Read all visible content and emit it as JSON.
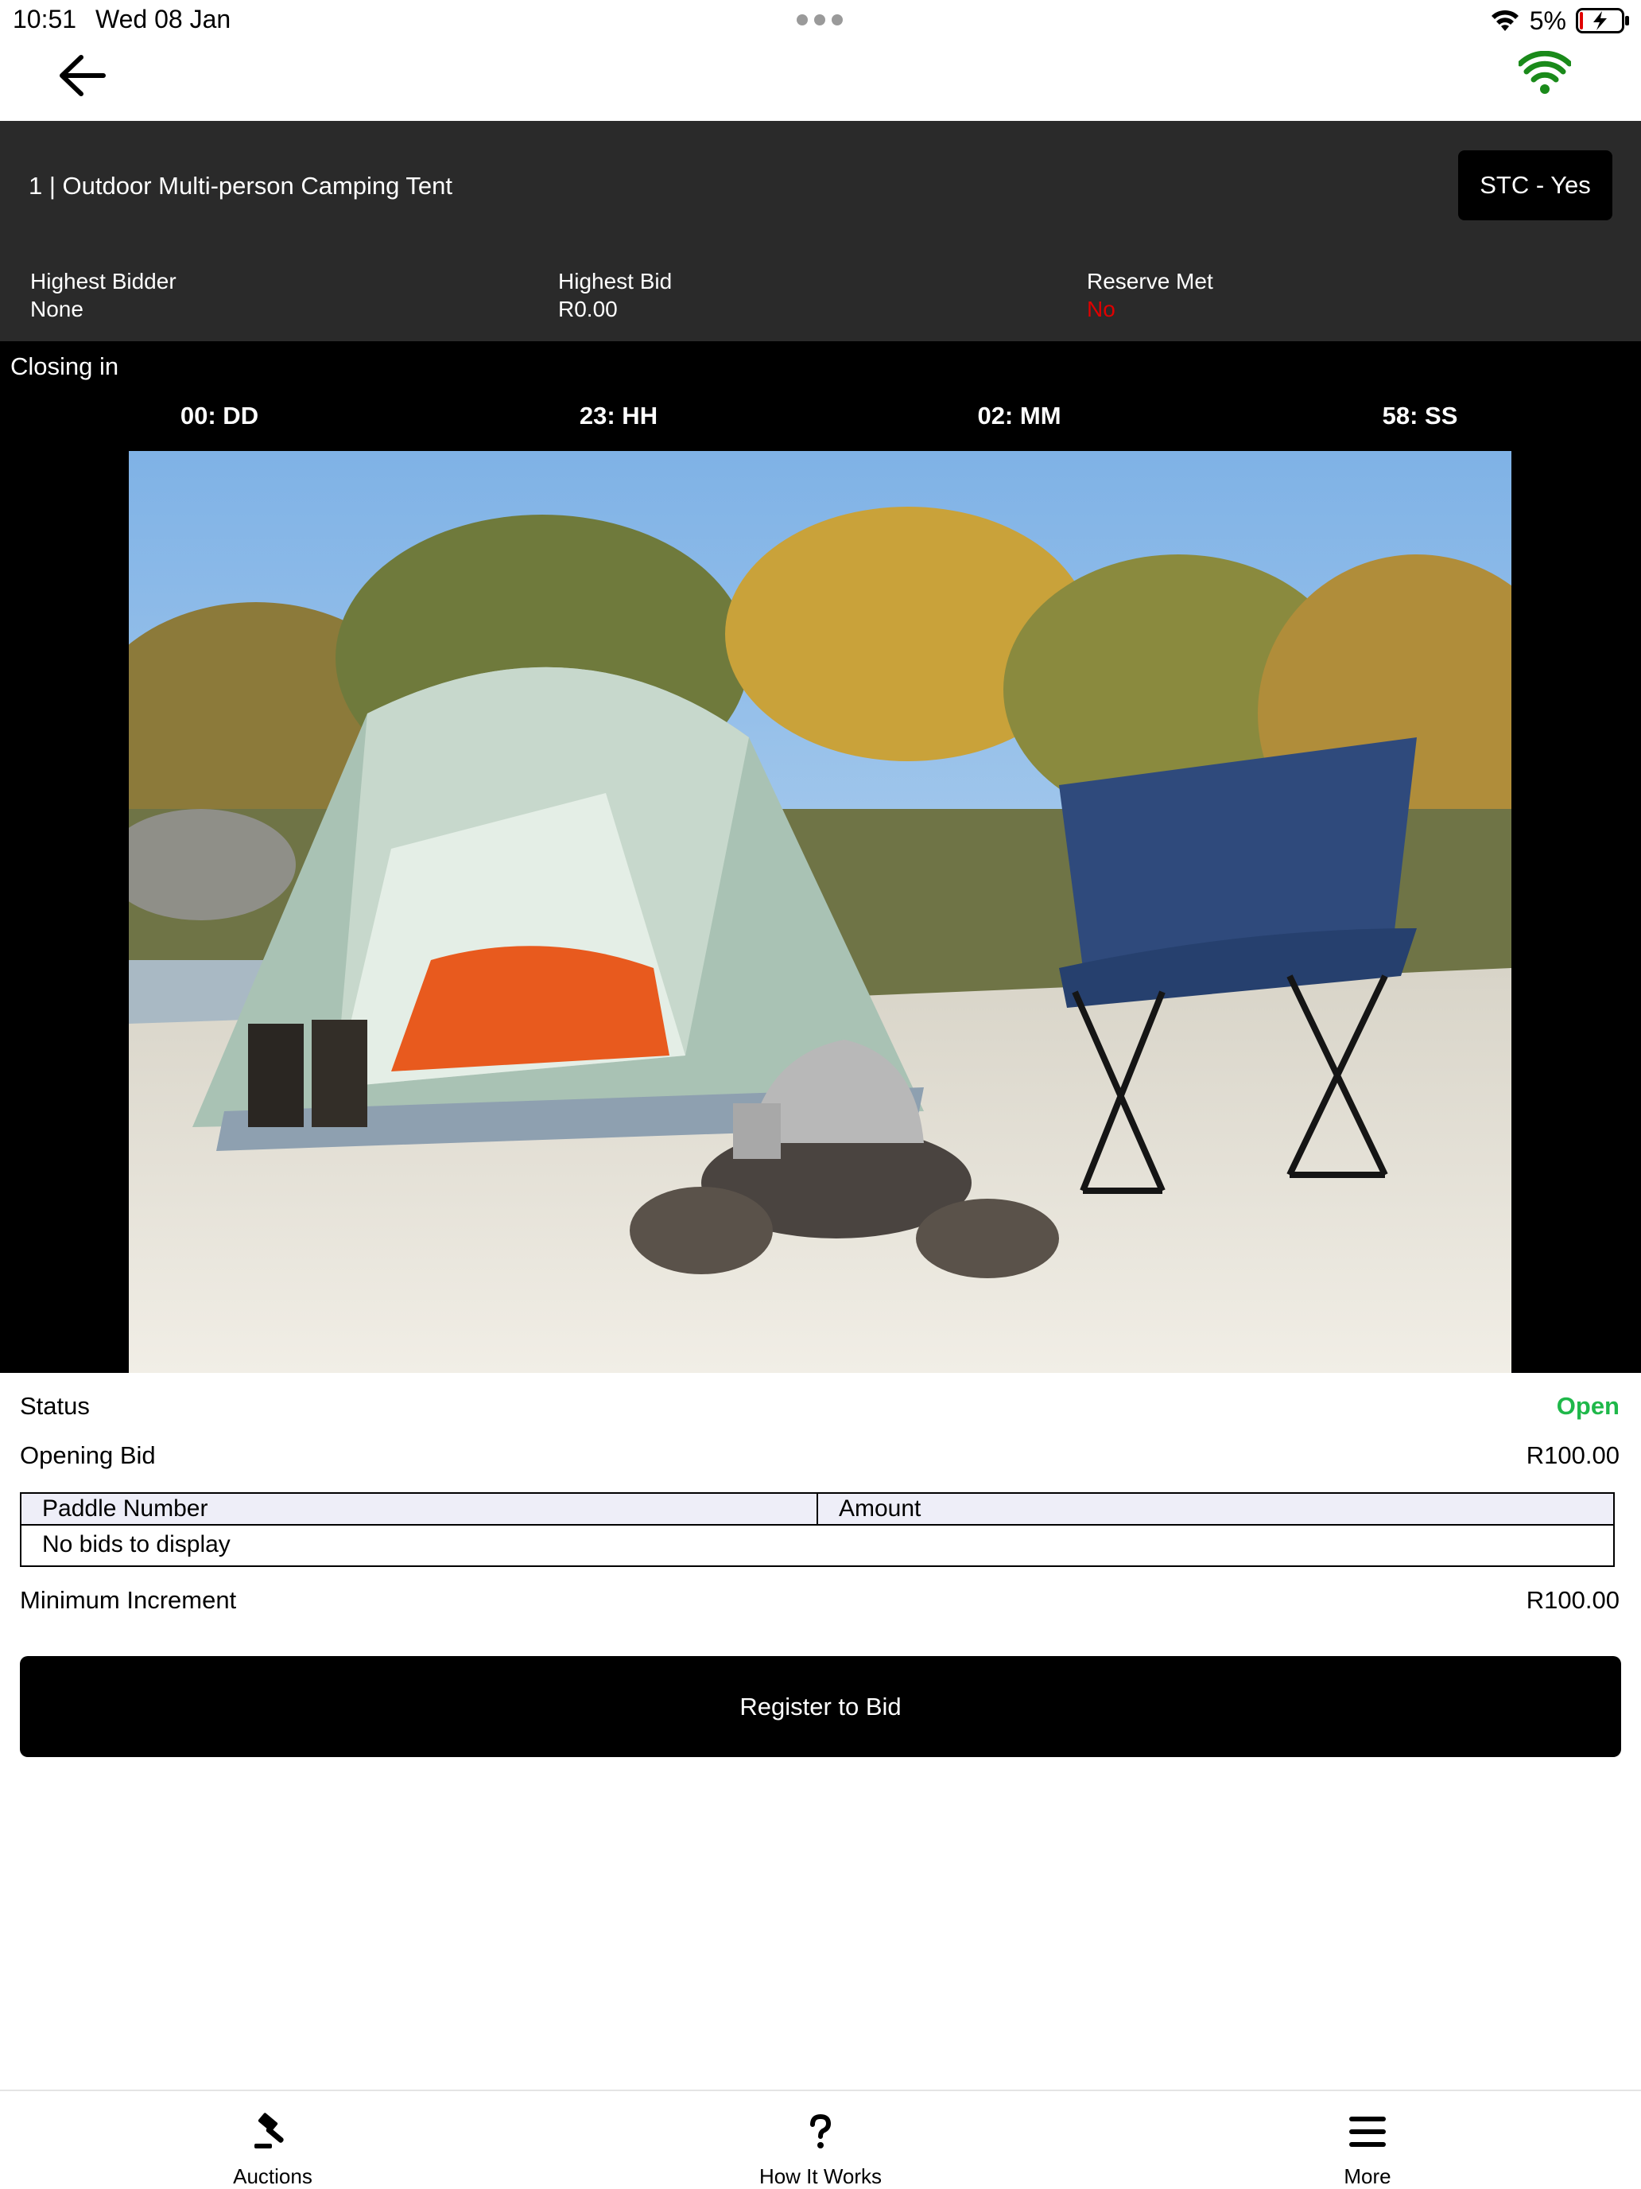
{
  "status_bar": {
    "time": "10:51",
    "date": "Wed 08 Jan",
    "battery_pct": "5%",
    "icons": [
      "wifi-icon",
      "battery-charging-icon"
    ]
  },
  "nav": {
    "back_icon": "arrow-left-icon",
    "connection_icon": "wifi-signal-icon",
    "connection_color": "#1a8a1a"
  },
  "lot": {
    "title": "1 | Outdoor Multi-person Camping Tent",
    "stc_label": "STC - Yes",
    "stats": [
      {
        "label": "Highest Bidder",
        "value": "None"
      },
      {
        "label": "Highest Bid",
        "value": "R0.00"
      },
      {
        "label": "Reserve Met",
        "value": "No"
      }
    ]
  },
  "countdown": {
    "label": "Closing in",
    "days": "00: DD",
    "hours": "23: HH",
    "minutes": "02: MM",
    "seconds": "58: SS"
  },
  "details": {
    "status_label": "Status",
    "status_value": "Open",
    "status_color": "#1fb84a",
    "opening_bid_label": "Opening Bid",
    "opening_bid_value": "R100.00",
    "min_increment_label": "Minimum Increment",
    "min_increment_value": "R100.00"
  },
  "bids_table": {
    "columns": [
      "Paddle Number",
      "Amount"
    ],
    "empty_text": "No bids to display"
  },
  "register_button": "Register to Bid",
  "tabs": [
    {
      "label": "Auctions",
      "icon": "gavel-icon"
    },
    {
      "label": "How It Works",
      "icon": "question-icon"
    },
    {
      "label": "More",
      "icon": "menu-icon"
    }
  ]
}
